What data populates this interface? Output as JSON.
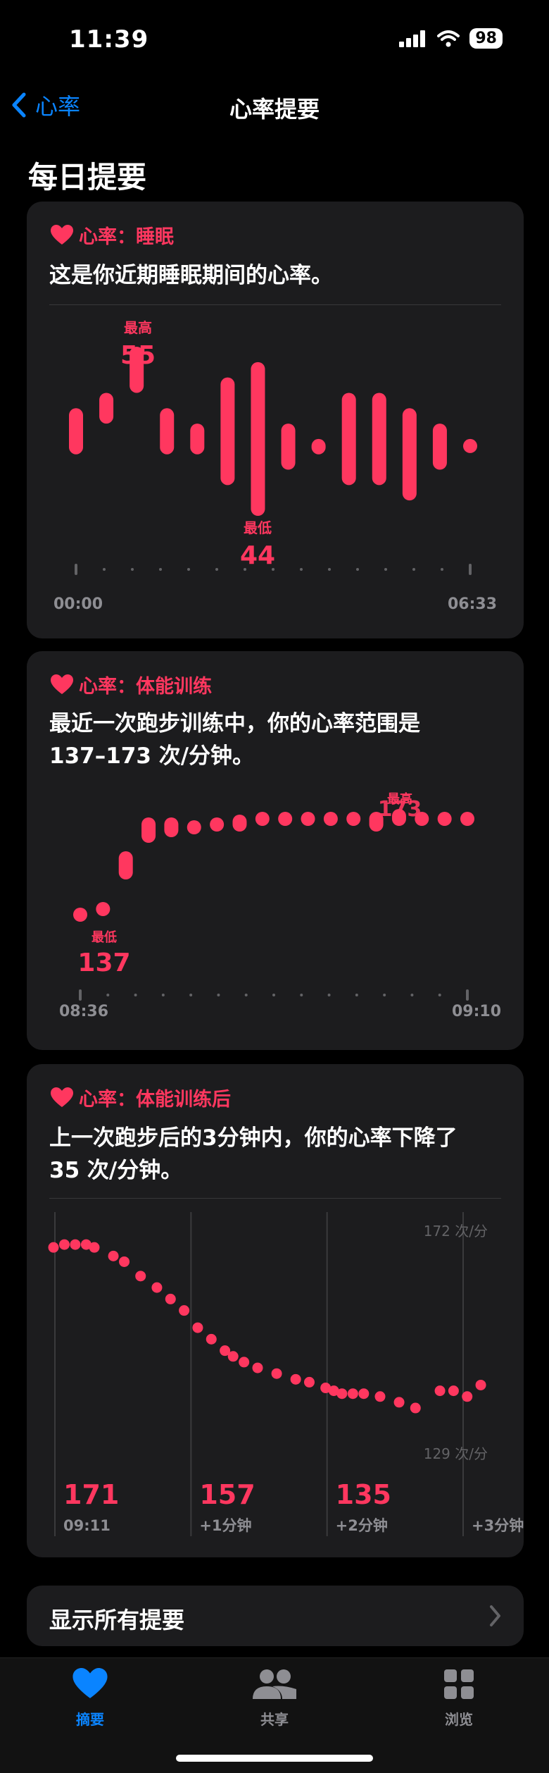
{
  "status": {
    "time": "11:39",
    "battery": "98"
  },
  "nav": {
    "back_label": "心率",
    "title": "心率提要"
  },
  "section_title": "每日提要",
  "card_sleep": {
    "header": "心率：睡眠",
    "text": "这是你近期睡眠期间的心率。",
    "max_label": "最高",
    "max_value": "55",
    "min_label": "最低",
    "min_value": "44",
    "x_start": "00:00",
    "x_end": "06:33",
    "chart_data": {
      "type": "bar",
      "series": [
        {
          "values": [
            [
              48,
              51
            ],
            [
              50,
              52
            ],
            [
              52,
              55
            ],
            [
              48,
              51
            ],
            [
              48,
              50
            ],
            [
              46,
              53
            ],
            [
              44,
              54
            ],
            [
              47,
              50
            ],
            [
              48,
              49
            ],
            [
              46,
              52
            ],
            [
              46,
              52
            ],
            [
              45,
              51
            ],
            [
              47,
              50
            ],
            [
              49,
              49
            ]
          ]
        }
      ],
      "ylim": [
        44,
        55
      ]
    }
  },
  "card_workout": {
    "header": "心率：体能训练",
    "text_line1": "最近一次跑步训练中，你的心率范围是",
    "text_line2": "137–173 次/分钟。",
    "max_label": "最高",
    "max_value": "173",
    "min_label": "最低",
    "min_value": "137",
    "x_start": "08:36",
    "x_end": "09:10",
    "chart_data": {
      "type": "bar",
      "series": [
        {
          "values": [
            [
              137,
              138
            ],
            [
              137,
              140
            ],
            [
              148,
              158
            ],
            [
              161,
              170
            ],
            [
              163,
              170
            ],
            [
              164,
              169
            ],
            [
              165,
              170
            ],
            [
              165,
              171
            ],
            [
              168,
              172
            ],
            [
              168,
              172
            ],
            [
              168,
              172
            ],
            [
              168,
              172
            ],
            [
              168,
              172
            ],
            [
              165,
              172
            ],
            [
              167,
              173
            ],
            [
              168,
              172
            ],
            [
              168,
              172
            ],
            [
              168,
              172
            ]
          ]
        }
      ],
      "ylim": [
        135,
        175
      ]
    }
  },
  "card_recovery": {
    "header": "心率：体能训练后",
    "text_line1": "上一次跑步后的3分钟内，你的心率下降了",
    "text_line2": "35 次/分钟。",
    "y_top": "172 次/分",
    "y_bottom": "129 次/分",
    "stats": [
      {
        "value": "171",
        "label": "09:11"
      },
      {
        "value": "157",
        "label": "+1分钟"
      },
      {
        "value": "135",
        "label": "+2分钟"
      },
      {
        "value": "",
        "label": "+3分钟"
      }
    ],
    "chart_data": {
      "type": "scatter",
      "x_minutes": [
        0,
        0.08,
        0.16,
        0.24,
        0.3,
        0.44,
        0.52,
        0.64,
        0.76,
        0.86,
        0.96,
        1.06,
        1.16,
        1.26,
        1.32,
        1.4,
        1.5,
        1.64,
        1.78,
        1.88,
        2.0,
        2.06,
        2.12,
        2.2,
        2.28,
        2.4,
        2.54,
        2.66,
        2.84,
        2.94,
        3.04,
        3.14
      ],
      "y_bpm": [
        171,
        171.5,
        171.5,
        171.5,
        171,
        169.5,
        168.5,
        166,
        164,
        162,
        160,
        157,
        155,
        153,
        152,
        151,
        150,
        149,
        148,
        147.5,
        146.5,
        146,
        145.5,
        145.5,
        145.5,
        145,
        144,
        143,
        146,
        146,
        145,
        147
      ],
      "ylim": [
        129,
        172
      ],
      "xlim": [
        0,
        3
      ]
    }
  },
  "show_all": "显示所有提要",
  "tabs": [
    {
      "label": "摘要",
      "icon": "heart-icon"
    },
    {
      "label": "共享",
      "icon": "people-icon"
    },
    {
      "label": "浏览",
      "icon": "grid-icon"
    }
  ],
  "colors": {
    "accent": "#0a84ff",
    "heart": "#ff375f",
    "card": "#1c1c1e"
  }
}
